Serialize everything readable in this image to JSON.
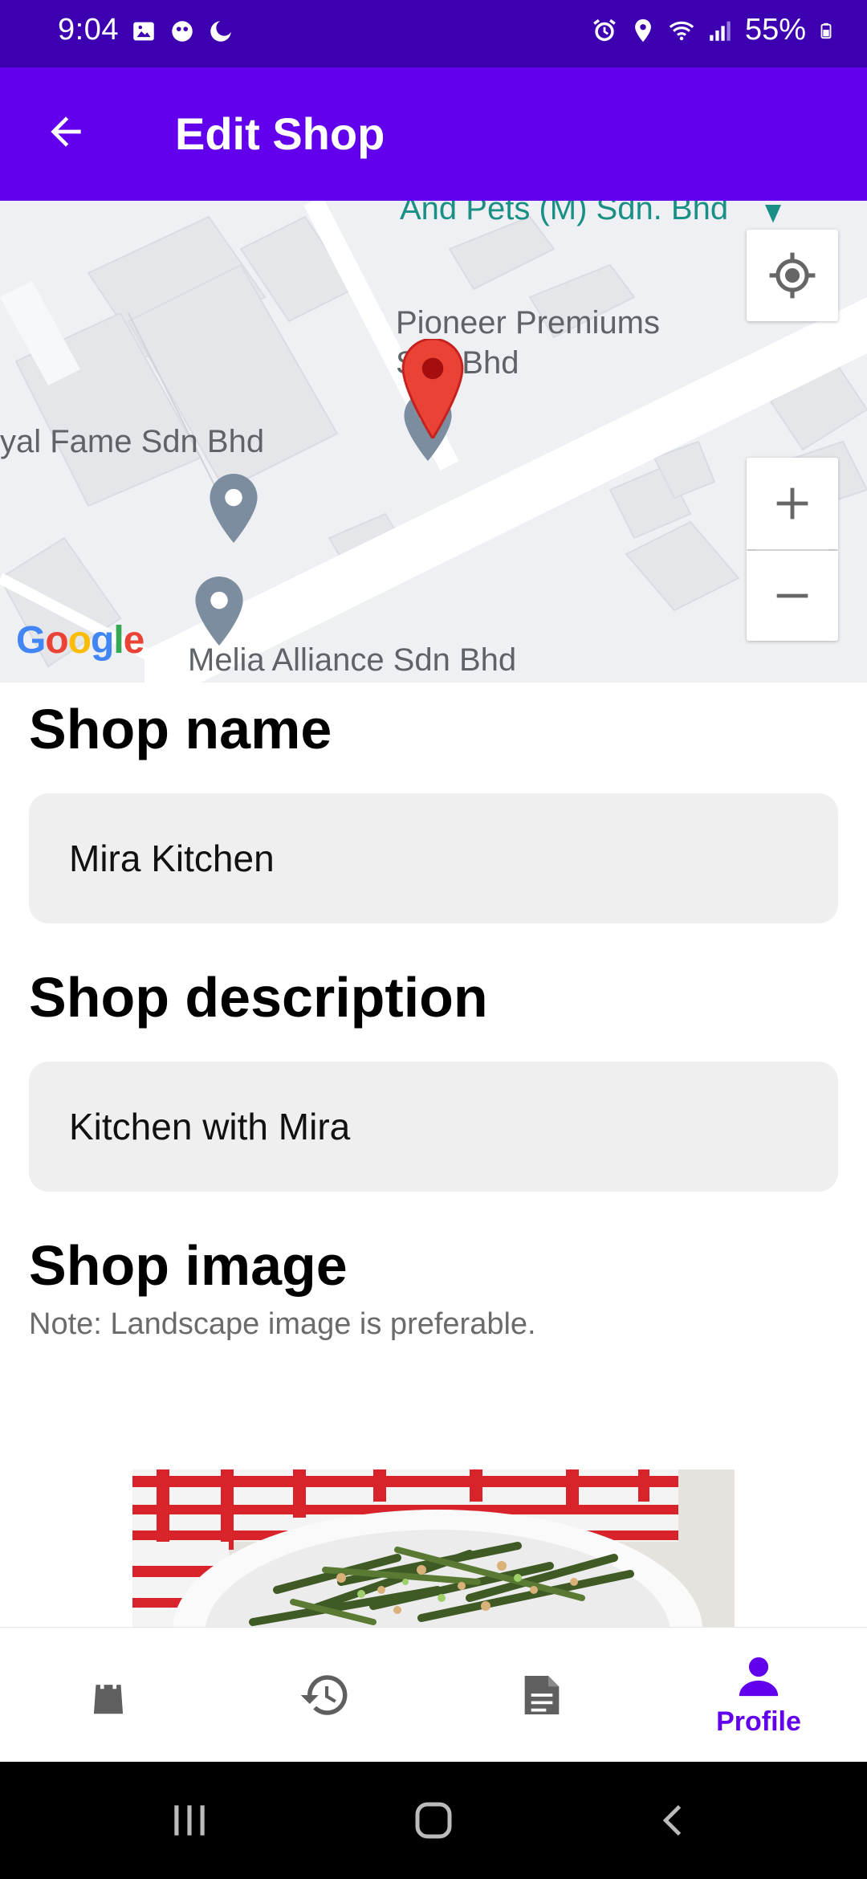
{
  "status_bar": {
    "time": "9:04",
    "battery": "55%",
    "left_icons": [
      "gallery-icon",
      "notification-icon",
      "moon-icon"
    ],
    "right_icons": [
      "alarm-icon",
      "location-icon",
      "wifi-icon",
      "signal-icon",
      "battery-icon"
    ]
  },
  "app_bar": {
    "title": "Edit Shop",
    "back_icon": "arrow-back-icon"
  },
  "map": {
    "labels": {
      "top": "And Pets (M) Sdn. Bhd",
      "pioneer_line1": "Pioneer Premiums",
      "pioneer_line2": "Sdn Bhd",
      "royal": "yal Fame Sdn Bhd",
      "bottom": "Melia Alliance Sdn Bhd"
    },
    "attribution": "Google",
    "controls": [
      "my-location-icon",
      "zoom-in-icon",
      "zoom-out-icon"
    ],
    "colors": {
      "marker": "#ea4335",
      "poi": "#7b8d9e",
      "background": "#eef0f3"
    }
  },
  "form": {
    "shop_name_label": "Shop name",
    "shop_name_value": "Mira Kitchen",
    "shop_description_label": "Shop description",
    "shop_description_value": "Kitchen with Mira",
    "shop_image_label": "Shop image",
    "shop_image_note": "Note: Landscape image is preferable."
  },
  "bottom_nav": {
    "items": [
      {
        "icon": "shopping-bag-icon",
        "label": ""
      },
      {
        "icon": "history-icon",
        "label": ""
      },
      {
        "icon": "document-icon",
        "label": ""
      },
      {
        "icon": "profile-icon",
        "label": "Profile",
        "active": true
      }
    ],
    "colors": {
      "active": "#6200ee",
      "inactive": "#5f5f5f"
    }
  },
  "system_nav": [
    "recents-icon",
    "home-icon",
    "back-icon"
  ],
  "colors": {
    "status_bar": "#3c00b0",
    "app_bar": "#6200ee",
    "field_bg": "#efefef"
  }
}
